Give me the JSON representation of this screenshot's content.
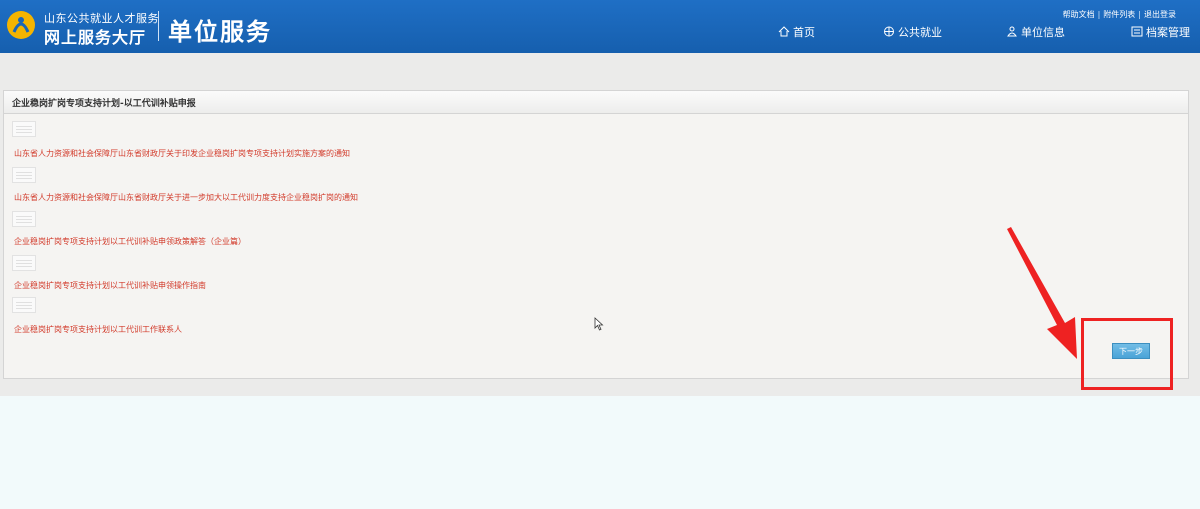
{
  "header": {
    "org_line1": "山东公共就业人才服务",
    "org_line2": "网上服务大厅",
    "section": "单位服务",
    "top_links": [
      "帮助文档",
      "附件列表",
      "退出登录"
    ],
    "top_link_sep": "|",
    "nav": [
      {
        "label": "首页",
        "icon": "home-icon"
      },
      {
        "label": "公共就业",
        "icon": "globe-icon"
      },
      {
        "label": "单位信息",
        "icon": "people-icon"
      },
      {
        "label": "档案管理",
        "icon": "archive-icon"
      }
    ]
  },
  "panel": {
    "title": "企业稳岗扩岗专项支持计划-以工代训补贴申报",
    "documents": [
      "山东省人力资源和社会保障厅山东省财政厅关于印发企业稳岗扩岗专项支持计划实施方案的通知",
      "山东省人力资源和社会保障厅山东省财政厅关于进一步加大以工代训力度支持企业稳岗扩岗的通知",
      "企业稳岗扩岗专项支持计划以工代训补贴申领政策解答（企业篇）",
      "企业稳岗扩岗专项支持计划以工代训补贴申领操作指南",
      "企业稳岗扩岗专项支持计划以工代训工作联系人"
    ],
    "next_button": "下一步"
  },
  "colors": {
    "header_blue": "#1a66b8",
    "link_red": "#d23a2a",
    "annotation_red": "#ee2222",
    "button_blue": "#4aa3d7"
  }
}
